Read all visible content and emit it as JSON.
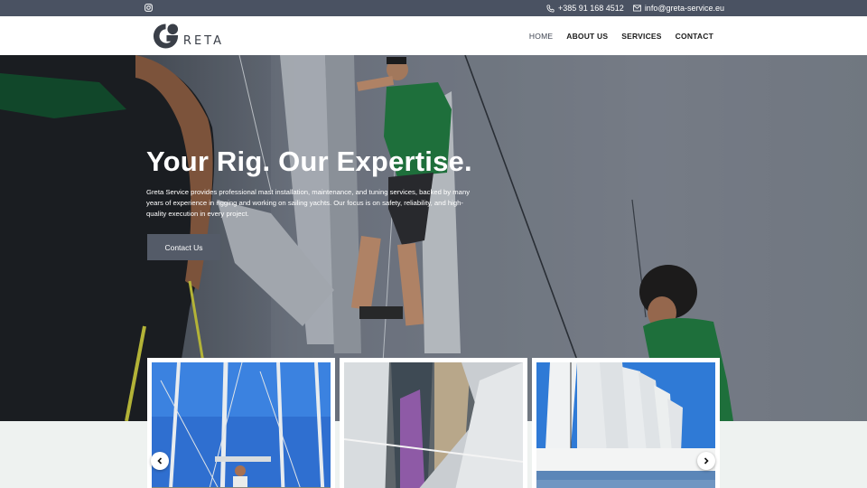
{
  "topbar": {
    "phone": "+385 91 168 4512",
    "email": "info@greta-service.eu",
    "social_icon": "instagram-icon"
  },
  "header": {
    "logo_text": "RETA",
    "nav": [
      {
        "label": "HOME",
        "active": true
      },
      {
        "label": "ABOUT US",
        "active": false
      },
      {
        "label": "SERVICES",
        "active": false
      },
      {
        "label": "CONTACT",
        "active": false
      }
    ]
  },
  "hero": {
    "title": "Your Rig. Our Expertise.",
    "description": "Greta Service provides professional mast installation, maintenance, and tuning services, backed by many years of experience in rigging and working on sailing yachts. Our focus is on safety, reliability, and high-quality execution in every project.",
    "cta_label": "Contact Us"
  },
  "gallery": {
    "prev_icon": "chevron-left-icon",
    "next_icon": "chevron-right-icon"
  },
  "colors": {
    "topbar_bg": "#4a5262",
    "button_bg": "#545b68",
    "shirt_green": "#1f7a3e",
    "sky_blue": "#2f6fd0"
  }
}
